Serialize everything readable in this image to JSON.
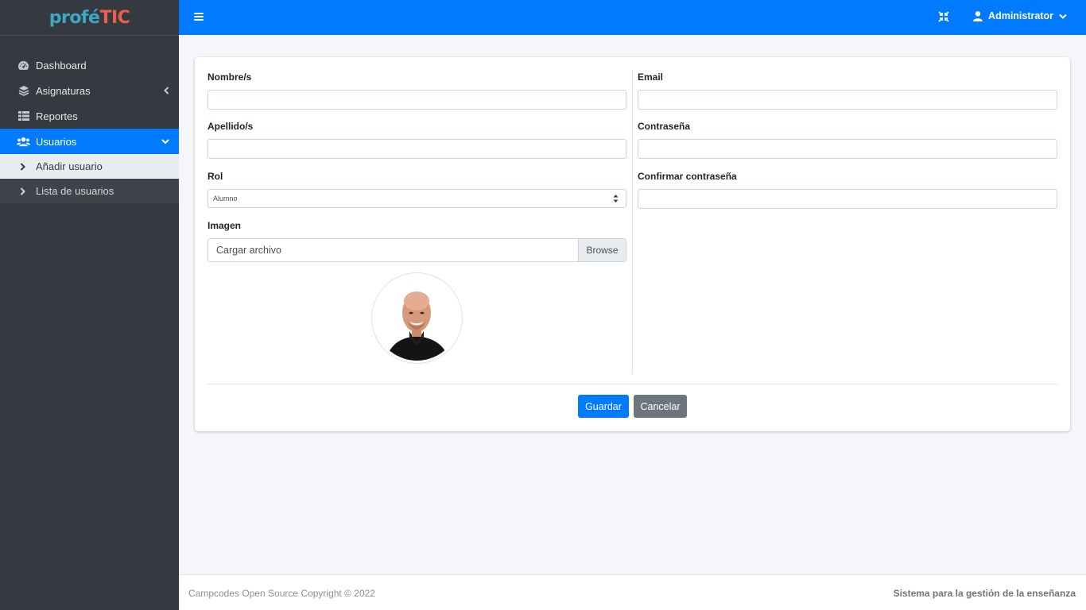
{
  "brand": {
    "part1": "profé",
    "part2": "TIC"
  },
  "sidebar": {
    "items": [
      {
        "label": "Dashboard",
        "icon": "tachometer-icon"
      },
      {
        "label": "Asignaturas",
        "icon": "layers-icon"
      },
      {
        "label": "Reportes",
        "icon": "table-icon"
      },
      {
        "label": "Usuarios",
        "icon": "users-icon"
      }
    ],
    "subitems": [
      {
        "label": "Añadir usuario"
      },
      {
        "label": "Lista de usuarios"
      }
    ]
  },
  "topbar": {
    "user_label": "Administrator"
  },
  "form": {
    "nombre_label": "Nombre/s",
    "apellido_label": "Apellido/s",
    "rol_label": "Rol",
    "rol_value": "Alumno",
    "imagen_label": "Imagen",
    "file_placeholder": "Cargar archivo",
    "browse_label": "Browse",
    "email_label": "Email",
    "password_label": "Contraseña",
    "confirm_label": "Confirmar contraseña",
    "save_label": "Guardar",
    "cancel_label": "Cancelar"
  },
  "footer": {
    "left_text": "Campcodes Open Source Copyright © 2022",
    "right_text": "Sistema para la gestión de la enseñanza"
  },
  "colors": {
    "primary": "#007bff",
    "sidebar": "#343a40",
    "secondary": "#6c757d"
  }
}
